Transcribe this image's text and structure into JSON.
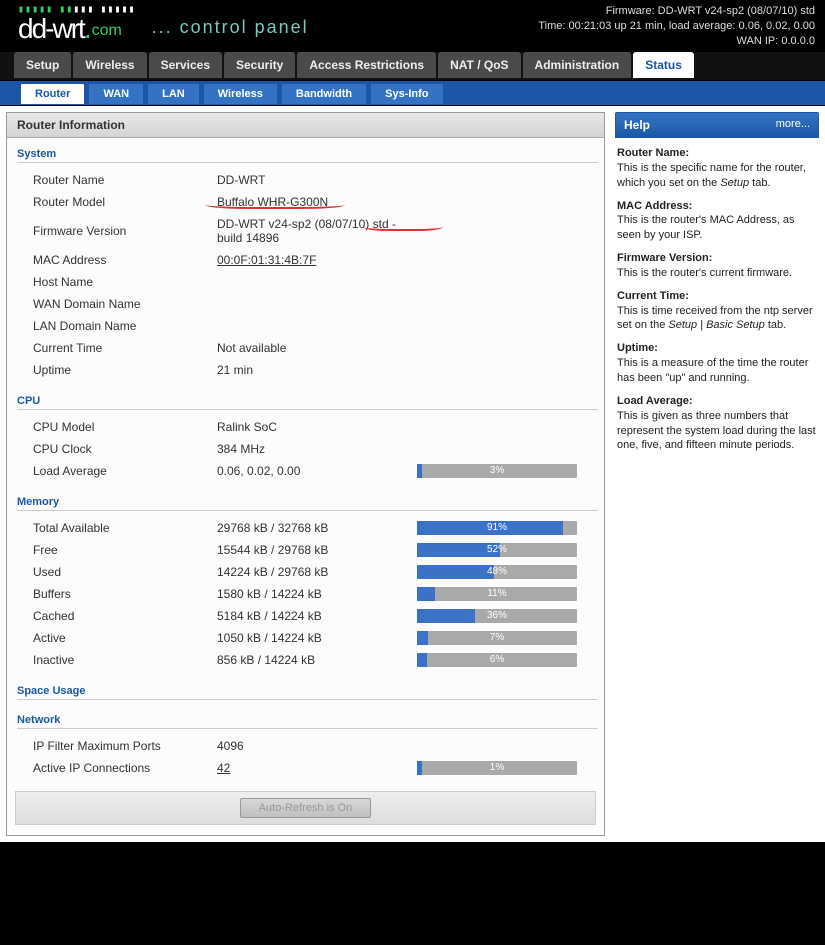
{
  "header": {
    "line1": "Firmware: DD-WRT v24-sp2 (08/07/10) std",
    "line2": "Time: 00:21:03 up 21 min, load average: 0.06, 0.02, 0.00",
    "line3": "WAN IP: 0.0.0.0",
    "logo_text": "dd-wrt",
    "logo_suffix": ".com",
    "subtitle": "... control panel"
  },
  "nav1": {
    "items": [
      {
        "label": "Setup"
      },
      {
        "label": "Wireless"
      },
      {
        "label": "Services"
      },
      {
        "label": "Security"
      },
      {
        "label": "Access Restrictions"
      },
      {
        "label": "NAT / QoS"
      },
      {
        "label": "Administration"
      },
      {
        "label": "Status",
        "active": true
      }
    ]
  },
  "nav2": {
    "items": [
      {
        "label": "Router",
        "active": true
      },
      {
        "label": "WAN"
      },
      {
        "label": "LAN"
      },
      {
        "label": "Wireless"
      },
      {
        "label": "Bandwidth"
      },
      {
        "label": "Sys-Info"
      }
    ]
  },
  "main_title": "Router Information",
  "system": {
    "title": "System",
    "rows": [
      {
        "key": "Router Name",
        "val": "DD-WRT"
      },
      {
        "key": "Router Model",
        "val": "Buffalo WHR-G300N"
      },
      {
        "key": "Firmware Version",
        "val": "DD-WRT v24-sp2 (08/07/10) std - build 14896"
      },
      {
        "key": "MAC Address",
        "val": "00:0F:01:31:4B:7F",
        "link": true
      },
      {
        "key": "Host Name",
        "val": ""
      },
      {
        "key": "WAN Domain Name",
        "val": ""
      },
      {
        "key": "LAN Domain Name",
        "val": ""
      },
      {
        "key": "Current Time",
        "val": "Not available"
      },
      {
        "key": "Uptime",
        "val": "21 min"
      }
    ]
  },
  "cpu": {
    "title": "CPU",
    "rows": [
      {
        "key": "CPU Model",
        "val": "Ralink SoC"
      },
      {
        "key": "CPU Clock",
        "val": "384 MHz"
      },
      {
        "key": "Load Average",
        "val": "0.06, 0.02, 0.00",
        "pct": 3
      }
    ]
  },
  "memory": {
    "title": "Memory",
    "rows": [
      {
        "key": "Total Available",
        "val": "29768 kB / 32768 kB",
        "pct": 91
      },
      {
        "key": "Free",
        "val": "15544 kB / 29768 kB",
        "pct": 52
      },
      {
        "key": "Used",
        "val": "14224 kB / 29768 kB",
        "pct": 48
      },
      {
        "key": "Buffers",
        "val": "1580 kB / 14224 kB",
        "pct": 11
      },
      {
        "key": "Cached",
        "val": "5184 kB / 14224 kB",
        "pct": 36
      },
      {
        "key": "Active",
        "val": "1050 kB / 14224 kB",
        "pct": 7
      },
      {
        "key": "Inactive",
        "val": "856 kB / 14224 kB",
        "pct": 6
      }
    ]
  },
  "space": {
    "title": "Space Usage"
  },
  "network": {
    "title": "Network",
    "rows": [
      {
        "key": "IP Filter Maximum Ports",
        "val": "4096"
      },
      {
        "key": "Active IP Connections",
        "val": "42",
        "link": true,
        "pct": 1
      }
    ]
  },
  "footer_btn": "Auto-Refresh is On",
  "help": {
    "title": "Help",
    "more": "more...",
    "items": [
      {
        "title": "Router Name:",
        "text": "This is the specific name for the router, which you set on the ",
        "em": "Setup",
        "text2": " tab."
      },
      {
        "title": "MAC Address:",
        "text": "This is the router's MAC Address, as seen by your ISP."
      },
      {
        "title": "Firmware Version:",
        "text": "This is the router's current firmware."
      },
      {
        "title": "Current Time:",
        "text": "This is time received from the ntp server set on the ",
        "em": "Setup | Basic Setup",
        "text2": " tab."
      },
      {
        "title": "Uptime:",
        "text": "This is a measure of the time the router has been \"up\" and running."
      },
      {
        "title": "Load Average:",
        "text": "This is given as three numbers that represent the system load during the last one, five, and fifteen minute periods."
      }
    ]
  }
}
